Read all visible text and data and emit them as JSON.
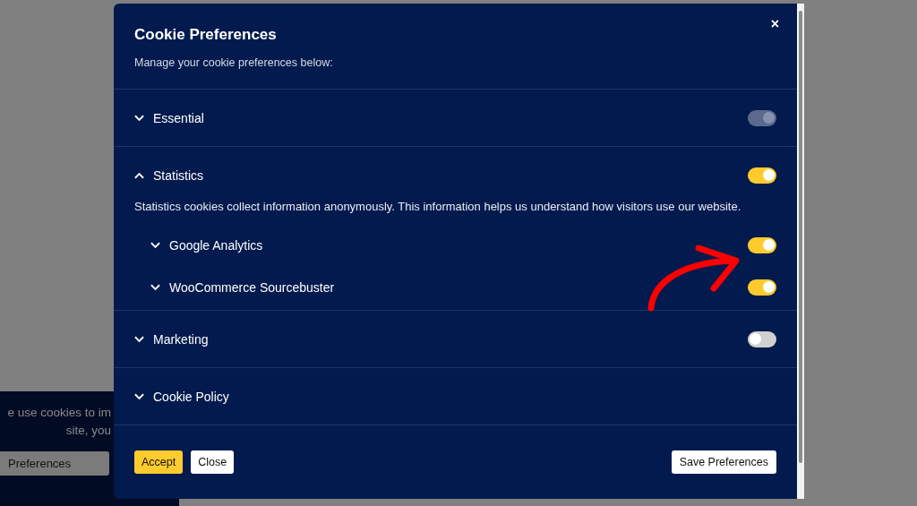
{
  "background_banner": {
    "message_lines": [
      "e use cookies to im",
      "site, you"
    ],
    "button": "Preferences"
  },
  "dialog": {
    "title": "Cookie Preferences",
    "subtitle": "Manage your cookie preferences below:",
    "close": "×",
    "categories": [
      {
        "label": "Essential",
        "expanded": false,
        "toggle": {
          "on": true,
          "disabled": true
        }
      },
      {
        "label": "Statistics",
        "expanded": true,
        "toggle": {
          "on": true,
          "disabled": false
        },
        "description": "Statistics cookies collect information anonymously. This information helps us understand how visitors use our website.",
        "children": [
          {
            "label": "Google Analytics",
            "expanded": false,
            "toggle": {
              "on": true,
              "disabled": false
            }
          },
          {
            "label": "WooCommerce Sourcebuster",
            "expanded": false,
            "toggle": {
              "on": true,
              "disabled": false
            }
          }
        ]
      },
      {
        "label": "Marketing",
        "expanded": false,
        "toggle": {
          "on": false,
          "disabled": false
        }
      },
      {
        "label": "Cookie Policy",
        "expanded": false
      }
    ],
    "buttons": [
      {
        "label": "Accept",
        "kind": "primary"
      },
      {
        "label": "Close",
        "kind": "secondary"
      },
      {
        "label": "Save Preferences",
        "kind": "save"
      }
    ]
  },
  "annotation": {
    "kind": "arrow"
  }
}
